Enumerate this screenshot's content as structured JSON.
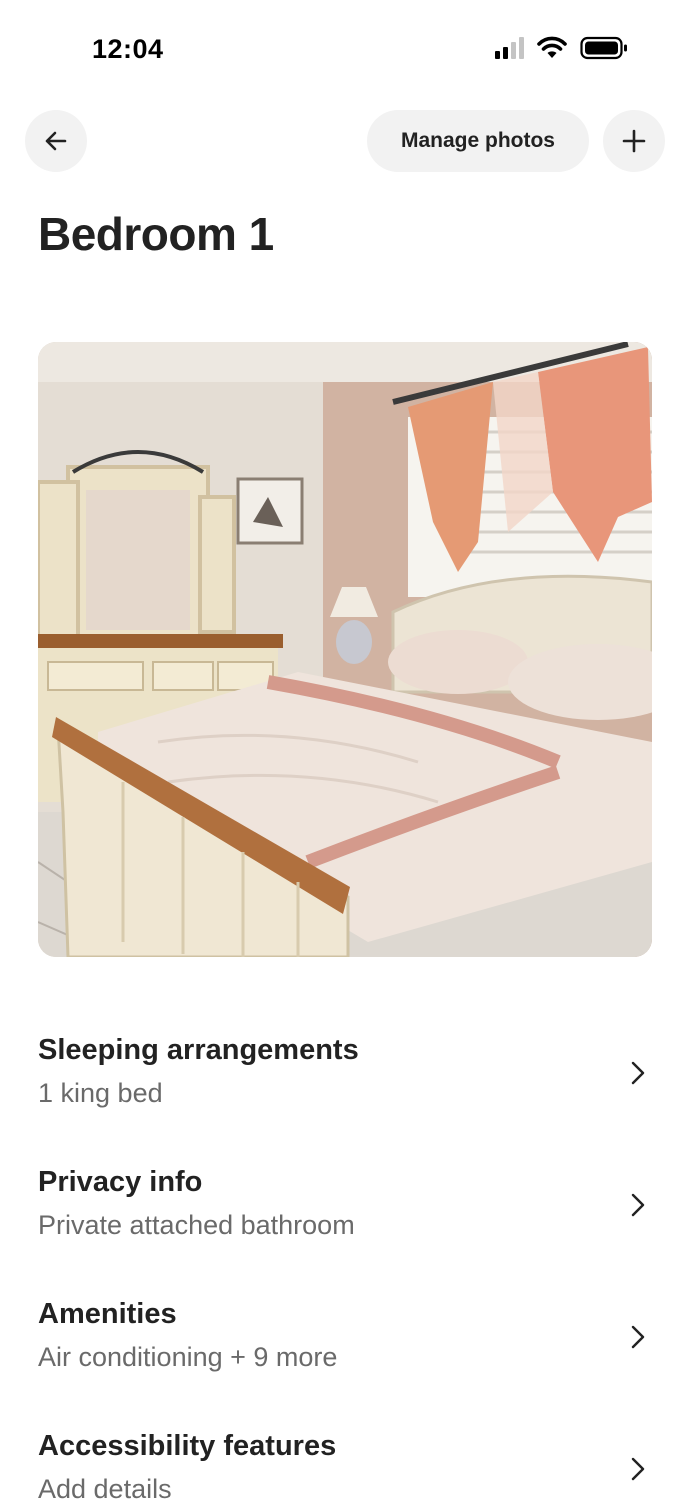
{
  "status_bar": {
    "time": "12:04"
  },
  "nav": {
    "manage_photos_label": "Manage photos"
  },
  "title": "Bedroom 1",
  "rows": [
    {
      "title": "Sleeping arrangements",
      "subtitle": "1 king bed"
    },
    {
      "title": "Privacy info",
      "subtitle": "Private attached bathroom"
    },
    {
      "title": "Amenities",
      "subtitle": "Air conditioning + 9 more"
    },
    {
      "title": "Accessibility features",
      "subtitle": "Add details"
    }
  ],
  "icons": {
    "back": "arrow-left-icon",
    "add": "plus-icon",
    "row_chevron": "chevron-right-icon"
  },
  "colors": {
    "text_primary": "#222222",
    "text_secondary": "#6a6a6a",
    "button_bg": "#f2f2f2"
  }
}
